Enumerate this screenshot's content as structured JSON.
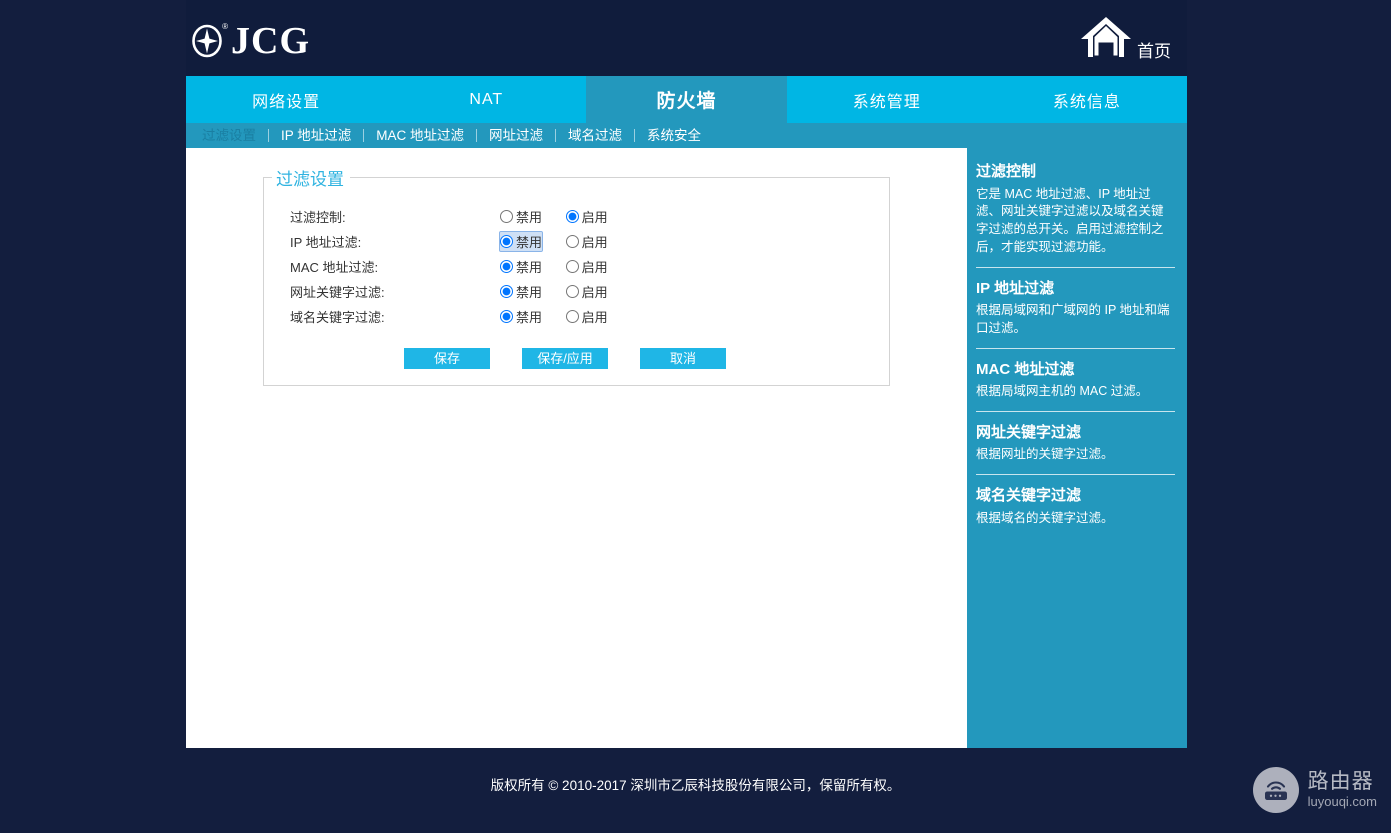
{
  "header": {
    "brand": "JCG",
    "brand_reg": "®",
    "home_label": "首页",
    "home_icon": "home-icon",
    "logo_icon": "jcg-logo-icon"
  },
  "nav_main": {
    "tabs": [
      {
        "label": "网络设置",
        "active": false
      },
      {
        "label": "NAT",
        "active": false
      },
      {
        "label": "防火墙",
        "active": true
      },
      {
        "label": "系统管理",
        "active": false
      },
      {
        "label": "系统信息",
        "active": false
      }
    ]
  },
  "nav_sub": {
    "tabs": [
      {
        "label": "过滤设置",
        "active": true
      },
      {
        "label": "IP 地址过滤",
        "active": false
      },
      {
        "label": "MAC 地址过滤",
        "active": false
      },
      {
        "label": "网址过滤",
        "active": false
      },
      {
        "label": "域名过滤",
        "active": false
      },
      {
        "label": "系统安全",
        "active": false
      }
    ]
  },
  "panel": {
    "legend": "过滤设置",
    "option_disable": "禁用",
    "option_enable": "启用",
    "rows": [
      {
        "label": "过滤控制:",
        "value": "启用",
        "focused": ""
      },
      {
        "label": "IP 地址过滤:",
        "value": "禁用",
        "focused": "disable"
      },
      {
        "label": "MAC 地址过滤:",
        "value": "禁用",
        "focused": ""
      },
      {
        "label": "网址关键字过滤:",
        "value": "禁用",
        "focused": ""
      },
      {
        "label": "域名关键字过滤:",
        "value": "禁用",
        "focused": ""
      }
    ],
    "buttons": {
      "save": "保存",
      "save_apply": "保存/应用",
      "cancel": "取消"
    }
  },
  "sidebar": {
    "sections": [
      {
        "title": "过滤控制",
        "body": "它是 MAC 地址过滤、IP 地址过滤、网址关键字过滤以及域名关键字过滤的总开关。启用过滤控制之后，才能实现过滤功能。"
      },
      {
        "title": "IP 地址过滤",
        "body": "根据局域网和广域网的 IP 地址和端口过滤。"
      },
      {
        "title": "MAC 地址过滤",
        "body": "根据局域网主机的 MAC 过滤。"
      },
      {
        "title": "网址关键字过滤",
        "body": "根据网址的关键字过滤。"
      },
      {
        "title": "域名关键字过滤",
        "body": "根据域名的关键字过滤。"
      }
    ]
  },
  "footer": {
    "copyright": "版权所有 © 2010-2017 深圳市乙辰科技股份有限公司，保留所有权。"
  },
  "watermark": {
    "icon": "router-icon",
    "cn": "路由器",
    "en": "luyouqi.com"
  },
  "colors": {
    "page_bg": "#131e3e",
    "header_bg": "#101c3c",
    "nav_bright": "#00b6e4",
    "nav_active": "#2398bd",
    "sidebar_bg": "#2398bd",
    "button": "#1fb6e6",
    "legend": "#2fb3e0",
    "content_bg": "#ffffff"
  }
}
